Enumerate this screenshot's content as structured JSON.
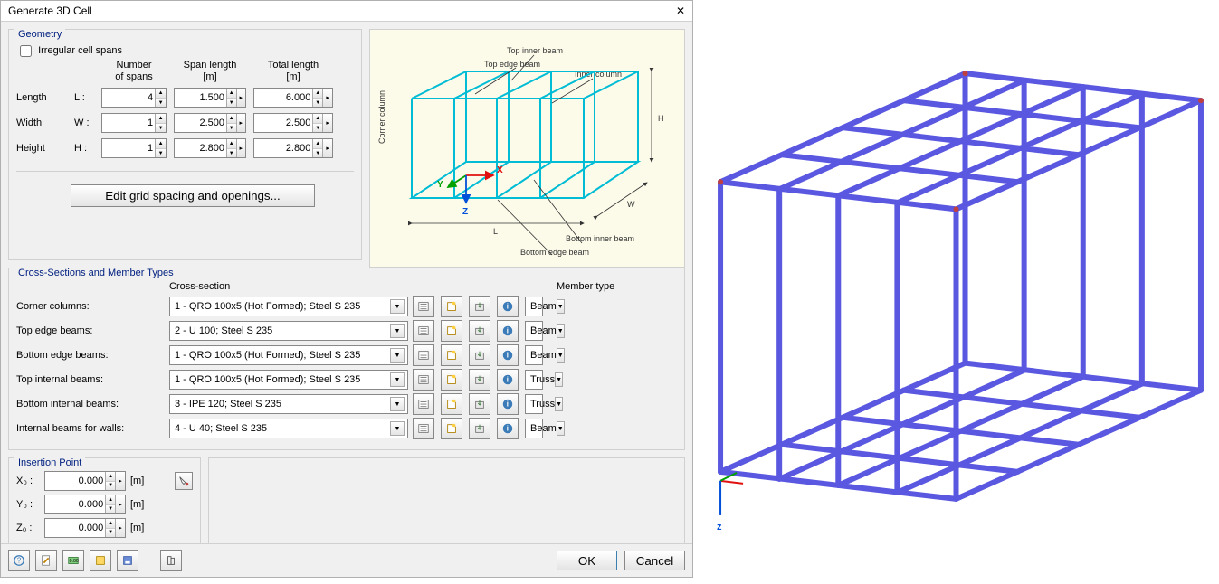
{
  "title": "Generate 3D Cell",
  "geometry": {
    "title": "Geometry",
    "irregular": "Irregular cell spans",
    "hdr_spans": "Number\nof spans",
    "hdr_spanlen": "Span length\n[m]",
    "hdr_total": "Total length\n[m]",
    "rows": [
      {
        "label": "Length",
        "sym": "L :",
        "spans": "4",
        "len": "1.500",
        "total": "6.000"
      },
      {
        "label": "Width",
        "sym": "W :",
        "spans": "1",
        "len": "2.500",
        "total": "2.500"
      },
      {
        "label": "Height",
        "sym": "H :",
        "spans": "1",
        "len": "2.800",
        "total": "2.800"
      }
    ],
    "edit_btn": "Edit grid spacing and openings..."
  },
  "diagram": {
    "top_inner": "Top inner beam",
    "top_edge": "Top edge beam",
    "inner_col": "Inner column",
    "corner_col": "Corner column",
    "bot_inner": "Bottom inner beam",
    "bot_edge": "Bottom edge beam",
    "L": "L",
    "W": "W",
    "H": "H",
    "X": "X",
    "Y": "Y",
    "Z": "Z"
  },
  "cross": {
    "title": "Cross-Sections and Member Types",
    "hdr_cs": "Cross-section",
    "hdr_mt": "Member type",
    "rows": [
      {
        "label": "Corner columns:",
        "cs": "1 - QRO 100x5 (Hot Formed); Steel S 235",
        "mt": "Beam"
      },
      {
        "label": "Top edge beams:",
        "cs": "2 - U 100; Steel S 235",
        "mt": "Beam"
      },
      {
        "label": "Bottom edge beams:",
        "cs": "1 - QRO 100x5 (Hot Formed); Steel S 235",
        "mt": "Beam"
      },
      {
        "label": "Top internal beams:",
        "cs": "1 - QRO 100x5 (Hot Formed); Steel S 235",
        "mt": "Truss"
      },
      {
        "label": "Bottom internal beams:",
        "cs": "3 - IPE 120; Steel S 235",
        "mt": "Truss"
      },
      {
        "label": "Internal beams for walls:",
        "cs": "4 - U 40; Steel S 235",
        "mt": "Beam"
      }
    ]
  },
  "insertion": {
    "title": "Insertion Point",
    "rows": [
      {
        "label": "X₀ :",
        "val": "0.000",
        "unit": "[m]"
      },
      {
        "label": "Y₀ :",
        "val": "0.000",
        "unit": "[m]"
      },
      {
        "label": "Z₀ :",
        "val": "0.000",
        "unit": "[m]"
      }
    ]
  },
  "buttons": {
    "ok": "OK",
    "cancel": "Cancel"
  },
  "viewer": {
    "z": "z"
  }
}
